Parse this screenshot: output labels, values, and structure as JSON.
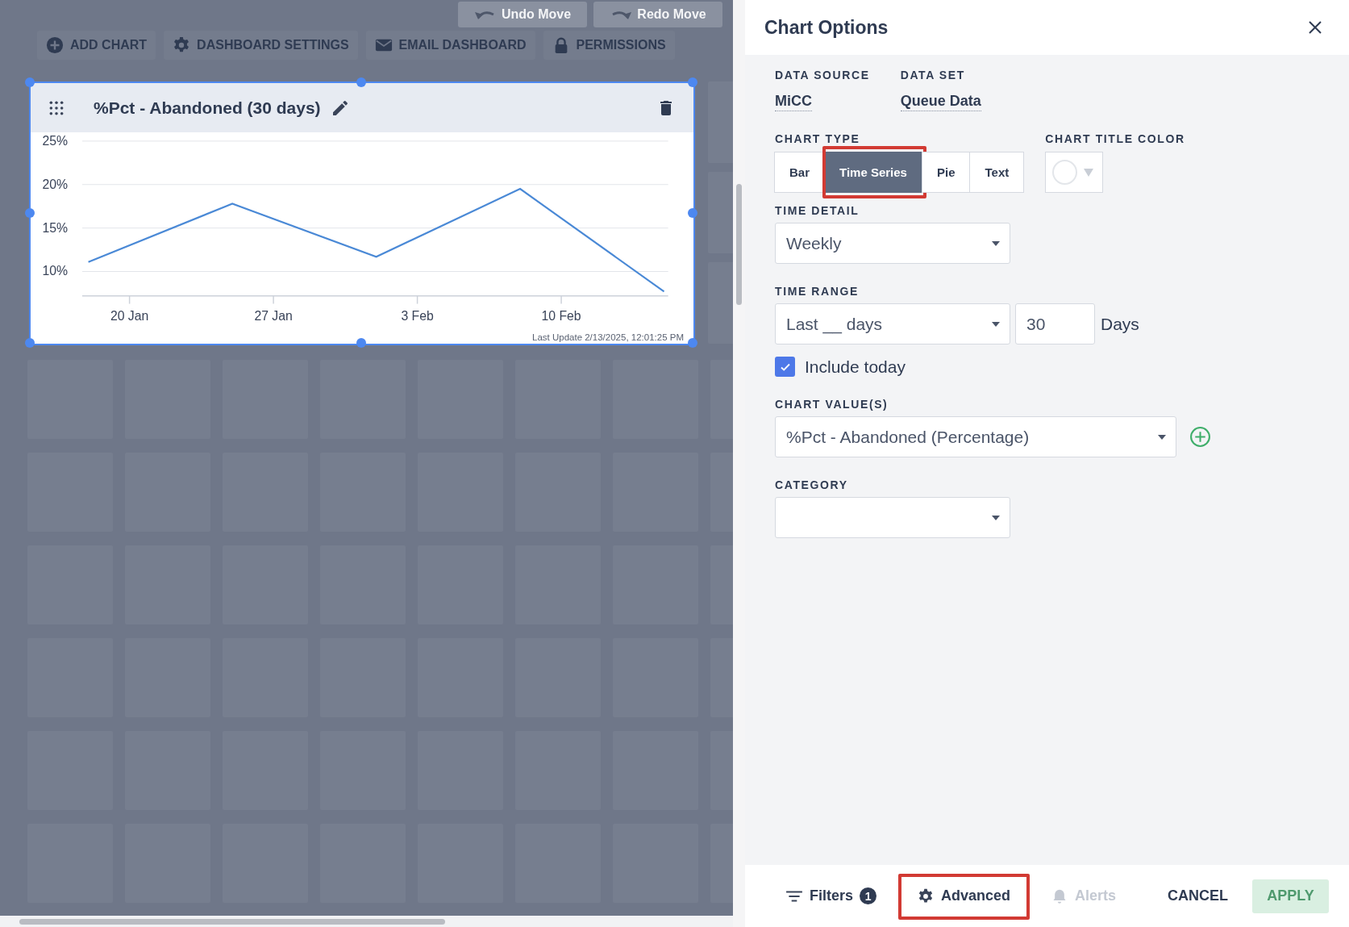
{
  "toolbar": [
    {
      "label": "ADD CHART"
    },
    {
      "label": "DASHBOARD SETTINGS"
    },
    {
      "label": "EMAIL DASHBOARD"
    },
    {
      "label": "PERMISSIONS"
    }
  ],
  "history": [
    {
      "label": "Undo Move"
    },
    {
      "label": "Redo Move"
    }
  ],
  "chart_card": {
    "title": "%Pct - Abandoned (30 days)",
    "last_update": "Last Update 2/13/2025, 12:01:25 PM",
    "chart_data": {
      "type": "line",
      "grid": true,
      "categories": [
        null,
        null,
        "20 Jan",
        null,
        null,
        null,
        null,
        null,
        null,
        "27 Jan",
        null,
        null,
        null,
        null,
        null,
        null,
        "3 Feb",
        null,
        null,
        null,
        null,
        null,
        null,
        "10 Feb",
        null,
        null,
        null,
        null,
        null
      ],
      "series": [
        {
          "color": "#4a89d6",
          "values": [
            11.1,
            null,
            null,
            null,
            null,
            null,
            null,
            17.8,
            null,
            null,
            null,
            null,
            null,
            null,
            11.7,
            null,
            null,
            null,
            null,
            null,
            null,
            19.5,
            null,
            null,
            null,
            null,
            null,
            null,
            7.7
          ]
        }
      ],
      "ylim": [
        7.2,
        25
      ],
      "yticks": [
        {
          "value": 10,
          "label": "10%"
        },
        {
          "value": 15,
          "label": "15%"
        },
        {
          "value": 20,
          "label": "20%"
        },
        {
          "value": 25,
          "label": "25%"
        }
      ]
    }
  },
  "panel": {
    "title": "Chart Options",
    "data_source": {
      "label": "DATA SOURCE",
      "value": "MiCC"
    },
    "data_set": {
      "label": "DATA SET",
      "value": "Queue Data"
    },
    "chart_type": {
      "label": "CHART TYPE",
      "options": [
        {
          "label": "Bar",
          "selected": false,
          "highlighted": false
        },
        {
          "label": "Time Series",
          "selected": true,
          "highlighted": true
        },
        {
          "label": "Pie",
          "selected": false,
          "highlighted": false
        },
        {
          "label": "Text",
          "selected": false,
          "highlighted": false
        }
      ]
    },
    "chart_title_color": {
      "label": "CHART TITLE COLOR"
    },
    "time_detail": {
      "label": "TIME DETAIL",
      "value": "Weekly"
    },
    "time_range": {
      "label": "TIME RANGE",
      "value": "Last __ days",
      "count": "30",
      "unit": "Days"
    },
    "include_today": {
      "label": "Include today",
      "checked": true
    },
    "chart_values": {
      "label": "CHART VALUE(S)",
      "value": "%Pct - Abandoned (Percentage)"
    },
    "category": {
      "label": "CATEGORY"
    }
  },
  "footer": {
    "filters": {
      "label": "Filters",
      "count": "1"
    },
    "advanced": {
      "label": "Advanced",
      "highlighted": true
    },
    "alerts": {
      "label": "Alerts",
      "disabled": true
    },
    "cancel": {
      "label": "CANCEL"
    },
    "apply": {
      "label": "APPLY",
      "disabled": true
    }
  }
}
